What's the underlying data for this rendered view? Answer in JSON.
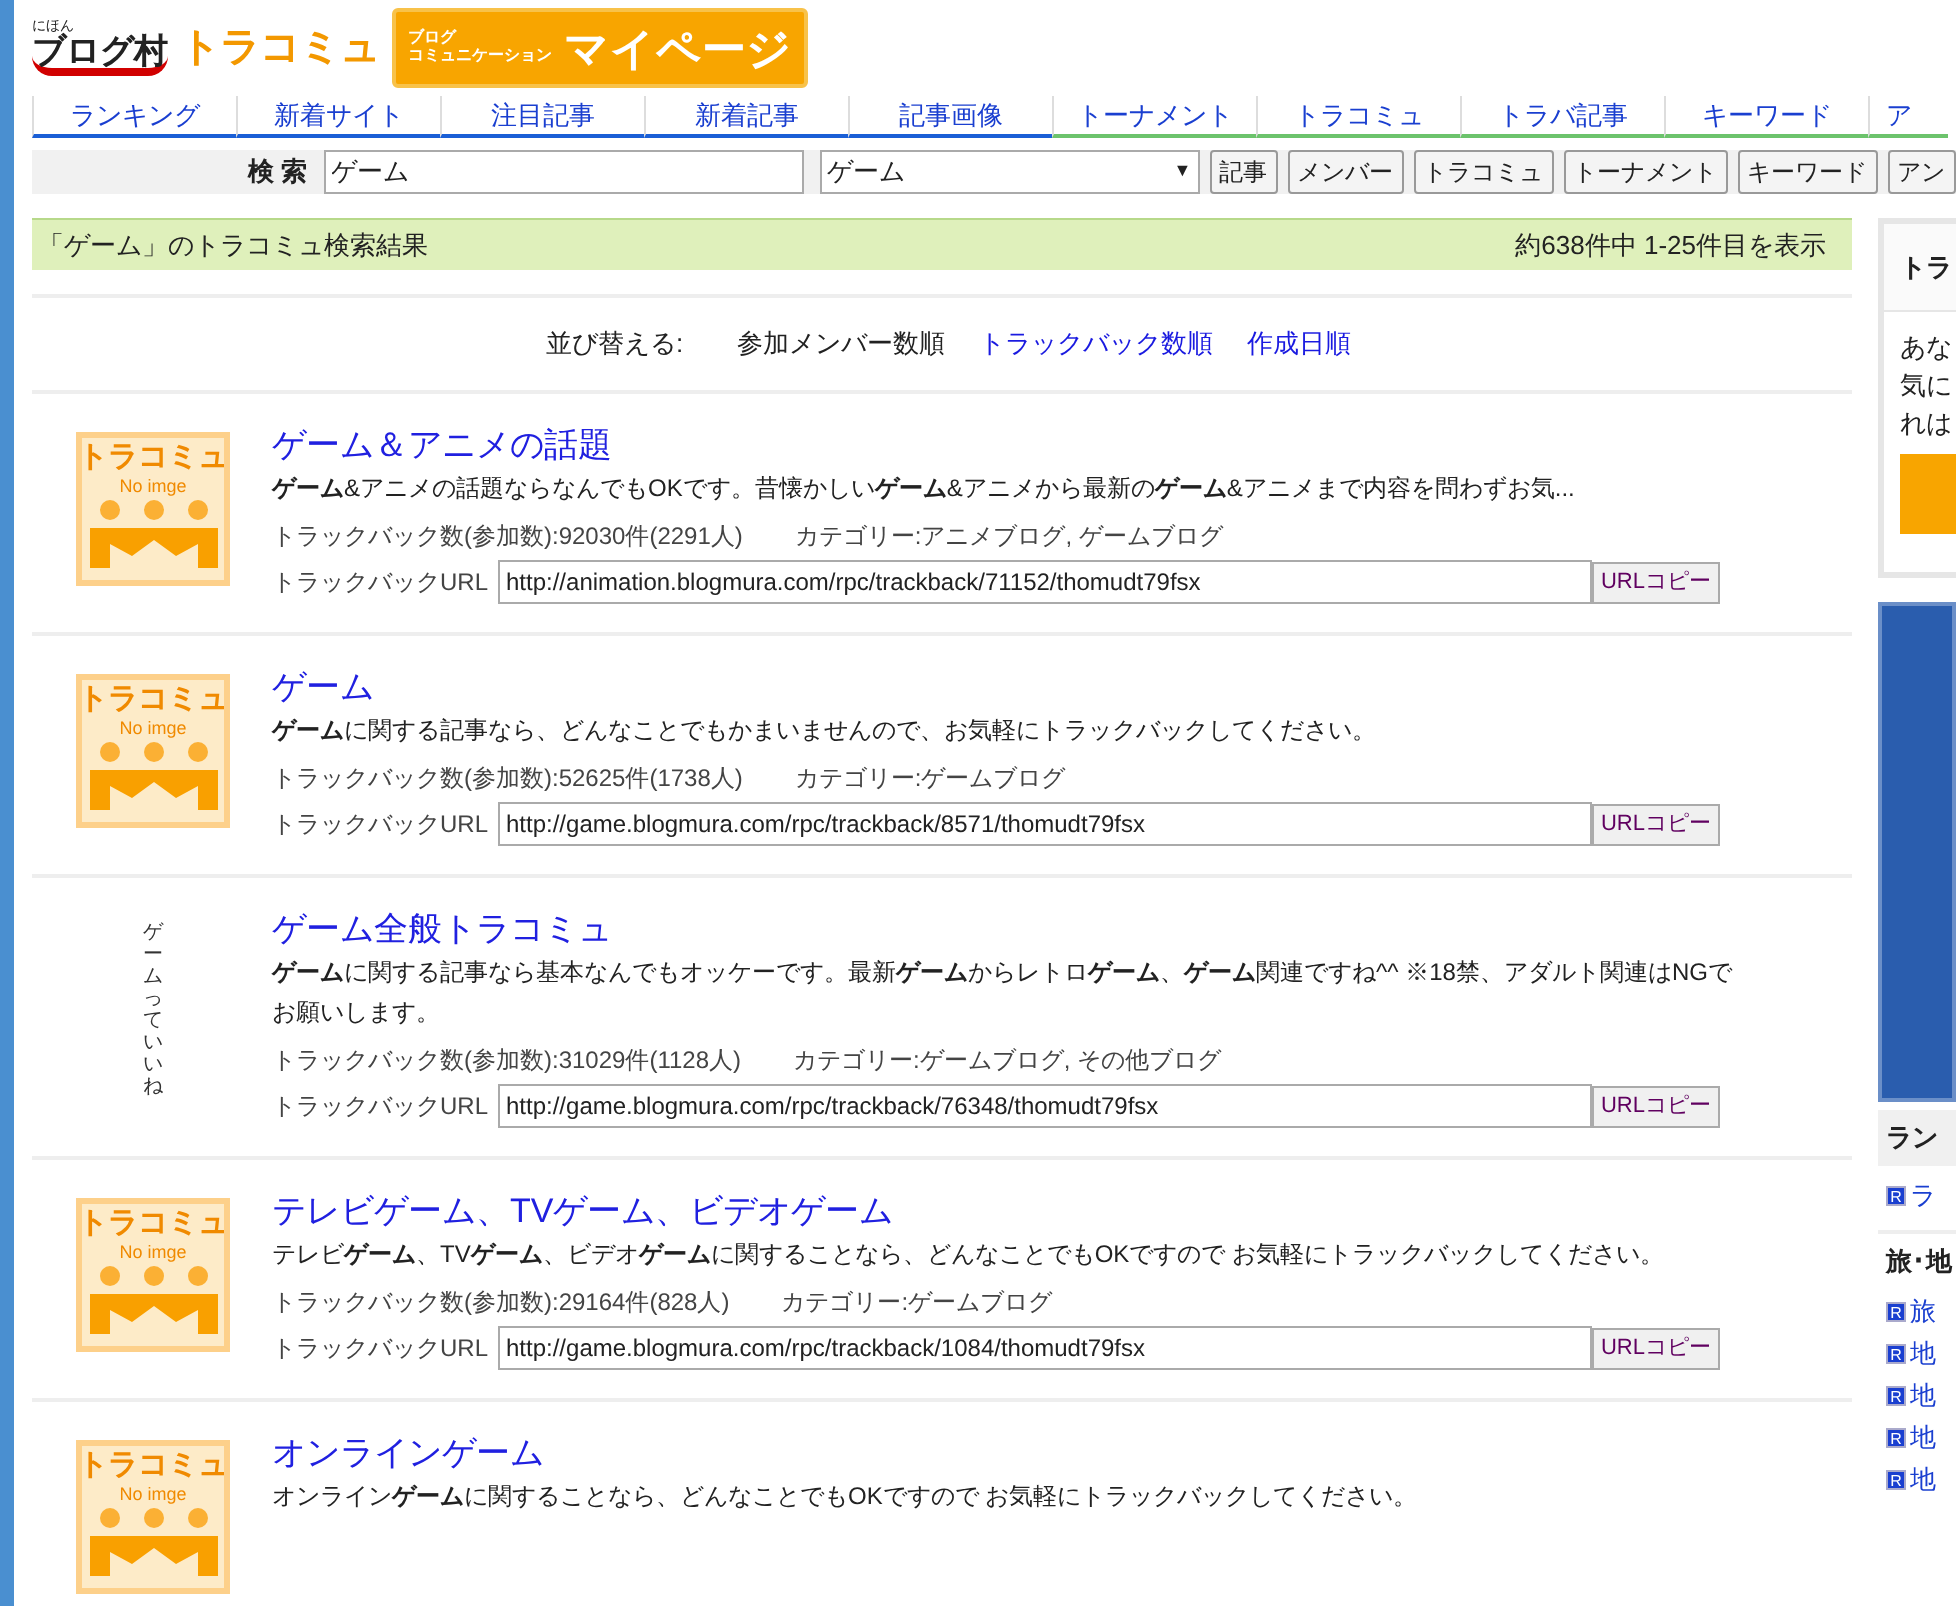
{
  "header": {
    "site_logo_small": "にほん",
    "site_logo": "ブログ村",
    "section_logo": "トラコミュ",
    "mypage_banner": {
      "line_1": "ブログ",
      "line_2": "コミュニケーション",
      "title": "マイページ"
    }
  },
  "nav_tabs": [
    {
      "label": "ランキング",
      "color": "#1a5fd6"
    },
    {
      "label": "新着サイト",
      "color": "#1a5fd6"
    },
    {
      "label": "注目記事",
      "color": "#1a5fd6"
    },
    {
      "label": "新着記事",
      "color": "#1a5fd6"
    },
    {
      "label": "記事画像",
      "color": "#1a5fd6"
    },
    {
      "label": "トーナメント",
      "color": "#6cc36c"
    },
    {
      "label": "トラコミュ",
      "color": "#6cc36c"
    },
    {
      "label": "トラバ記事",
      "color": "#6cc36c"
    },
    {
      "label": "キーワード",
      "color": "#6cc36c"
    },
    {
      "label": "ア",
      "color": "#6cc36c"
    }
  ],
  "search": {
    "label": "検 索",
    "value": "ゲーム",
    "category": "ゲーム",
    "dropdown_arrow": "▼",
    "buttons": [
      "記事",
      "メンバー",
      "トラコミュ",
      "トーナメント",
      "キーワード",
      "アン"
    ]
  },
  "results_bar": {
    "title": "「ゲーム」のトラコミュ検索結果",
    "count": "約638件中 1-25件目を表示"
  },
  "sort": {
    "label": "並び替える:",
    "options": [
      {
        "label": "参加メンバー数順",
        "selected": true
      },
      {
        "label": "トラックバック数順",
        "selected": false
      },
      {
        "label": "作成日順",
        "selected": false
      }
    ]
  },
  "results": [
    {
      "kind": "noimage",
      "thumb_title": "トラコミュ",
      "thumb_caption": "No imge",
      "title": "ゲーム＆アニメの話題",
      "description": "**ゲーム**&アニメの話題ならなんでもOKです。昔懐かしい**ゲーム**&アニメから最新の**ゲーム**&アニメまで内容を問わずお気...",
      "stats": "トラックバック数(参加数):92030件(2291人)",
      "category": "カテゴリー:アニメブログ, ゲームブログ",
      "url_label": "トラックバックURL",
      "url": "http://animation.blogmura.com/rpc/trackback/71152/thomudt79fsx",
      "copy_button": "URLコピー"
    },
    {
      "kind": "noimage",
      "thumb_title": "トラコミュ",
      "thumb_caption": "No imge",
      "title": "ゲーム",
      "description": "**ゲーム**に関する記事なら、どんなことでもかまいませんので、お気軽にトラックバックしてください。",
      "stats": "トラックバック数(参加数):52625件(1738人)",
      "category": "カテゴリー:ゲームブログ",
      "url_label": "トラックバックURL",
      "url": "http://game.blogmura.com/rpc/trackback/8571/thomudt79fsx",
      "copy_button": "URLコピー"
    },
    {
      "kind": "text",
      "thumb_text": "ゲームっていいね",
      "title": "ゲーム全般トラコミュ",
      "description": "**ゲーム**に関する記事なら基本なんでもオッケーです。最新**ゲーム**からレトロ**ゲーム**、**ゲーム**関連ですね^^ ※18禁、アダルト関連はNGでお願いします。",
      "stats": "トラックバック数(参加数):31029件(1128人)",
      "category": "カテゴリー:ゲームブログ, その他ブログ",
      "url_label": "トラックバックURL",
      "url": "http://game.blogmura.com/rpc/trackback/76348/thomudt79fsx",
      "copy_button": "URLコピー"
    },
    {
      "kind": "noimage",
      "thumb_title": "トラコミュ",
      "thumb_caption": "No imge",
      "title": "テレビゲーム、TVゲーム、ビデオゲーム",
      "description": "テレビ**ゲーム**、TV**ゲーム**、ビデオ**ゲーム**に関することなら、どんなことでもOKですので お気軽にトラックバックしてください。",
      "stats": "トラックバック数(参加数):29164件(828人)",
      "category": "カテゴリー:ゲームブログ",
      "url_label": "トラックバックURL",
      "url": "http://game.blogmura.com/rpc/trackback/1084/thomudt79fsx",
      "copy_button": "URLコピー"
    },
    {
      "kind": "noimage",
      "thumb_title": "トラコミュ",
      "thumb_caption": "No imge",
      "title": "オンラインゲーム",
      "description": "オンライン**ゲーム**に関することなら、どんなことでもOKですので お気軽にトラックバックしてください。"
    }
  ],
  "sidebar": {
    "box_title": "トラ",
    "box_lines": [
      "あな",
      "気に",
      "れは"
    ],
    "ranking_title": "ラン",
    "ranking_links": [
      {
        "marker": "R",
        "label": "ラ"
      }
    ],
    "region_title": "旅･地",
    "region_links": [
      {
        "marker": "R",
        "label": "旅"
      },
      {
        "marker": "R",
        "label": "地"
      },
      {
        "marker": "R",
        "label": "地"
      },
      {
        "marker": "R",
        "label": "地"
      },
      {
        "marker": "R",
        "label": "地"
      }
    ]
  }
}
